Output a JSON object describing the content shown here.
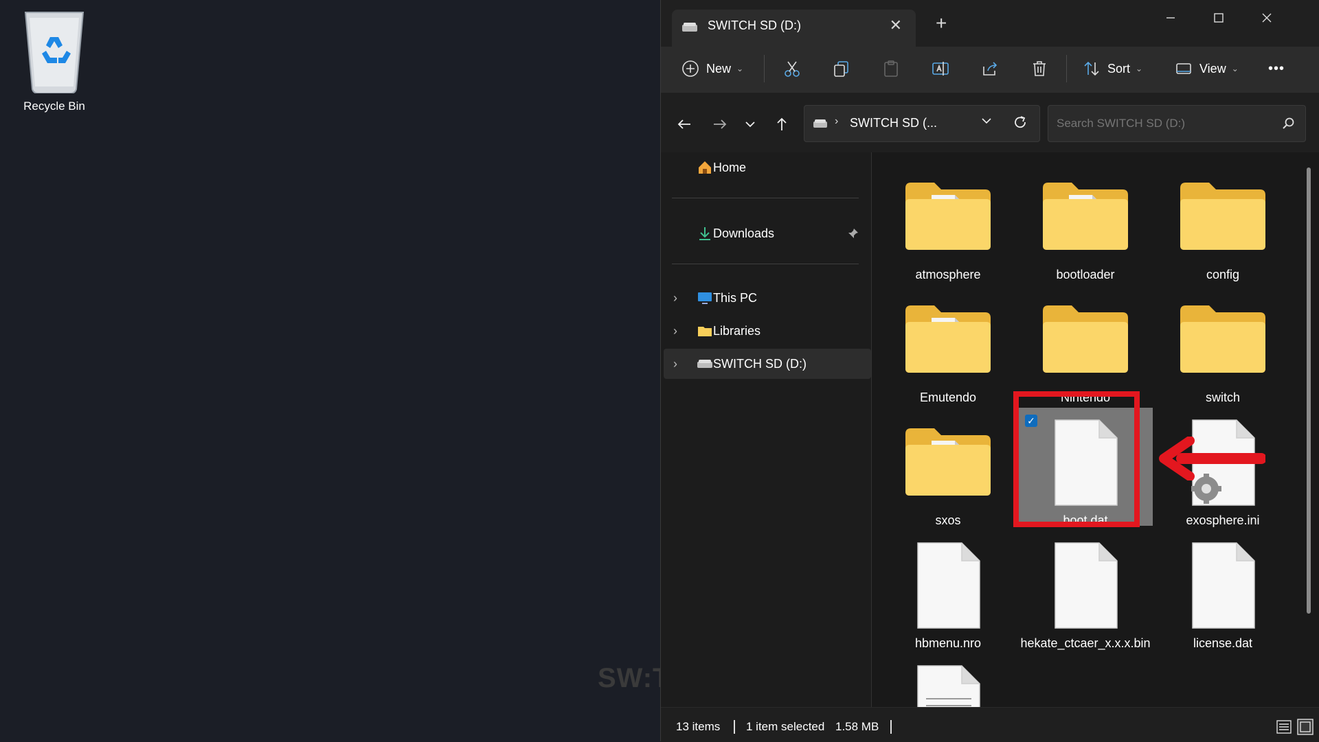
{
  "desktop": {
    "recycle_bin_label": "Recycle Bin",
    "watermark": "SW:TCHWAY"
  },
  "window": {
    "tab_title": "SWITCH SD (D:)",
    "toolbar": {
      "new_label": "New",
      "sort_label": "Sort",
      "view_label": "View",
      "more_label": "•••"
    },
    "address": {
      "text": "SWITCH SD (..."
    },
    "search": {
      "placeholder": "Search SWITCH SD (D:)"
    },
    "sidebar": {
      "items": [
        {
          "label": "Home"
        },
        {
          "label": "Downloads"
        },
        {
          "label": "This PC"
        },
        {
          "label": "Libraries"
        },
        {
          "label": "SWITCH SD (D:)"
        }
      ]
    },
    "files": [
      {
        "name": "atmosphere",
        "type": "folder-doc"
      },
      {
        "name": "bootloader",
        "type": "folder-doc"
      },
      {
        "name": "config",
        "type": "folder"
      },
      {
        "name": "Emutendo",
        "type": "folder-doc"
      },
      {
        "name": "Nintendo",
        "type": "folder"
      },
      {
        "name": "switch",
        "type": "folder"
      },
      {
        "name": "sxos",
        "type": "folder-doc"
      },
      {
        "name": "boot.dat",
        "type": "file",
        "selected": true
      },
      {
        "name": "exosphere.ini",
        "type": "settings-file"
      },
      {
        "name": "hbmenu.nro",
        "type": "file"
      },
      {
        "name": "hekate_ctcaer_x.x.x.bin",
        "type": "file"
      },
      {
        "name": "license.dat",
        "type": "file"
      },
      {
        "name": "",
        "type": "text-file"
      }
    ],
    "status": {
      "items_count": "13 items",
      "selected_text": "1 item selected",
      "size": "1.58 MB"
    }
  },
  "colors": {
    "accent": "#0f6cbd",
    "highlight": "#e3171f",
    "folder": "#f8cf5a"
  }
}
